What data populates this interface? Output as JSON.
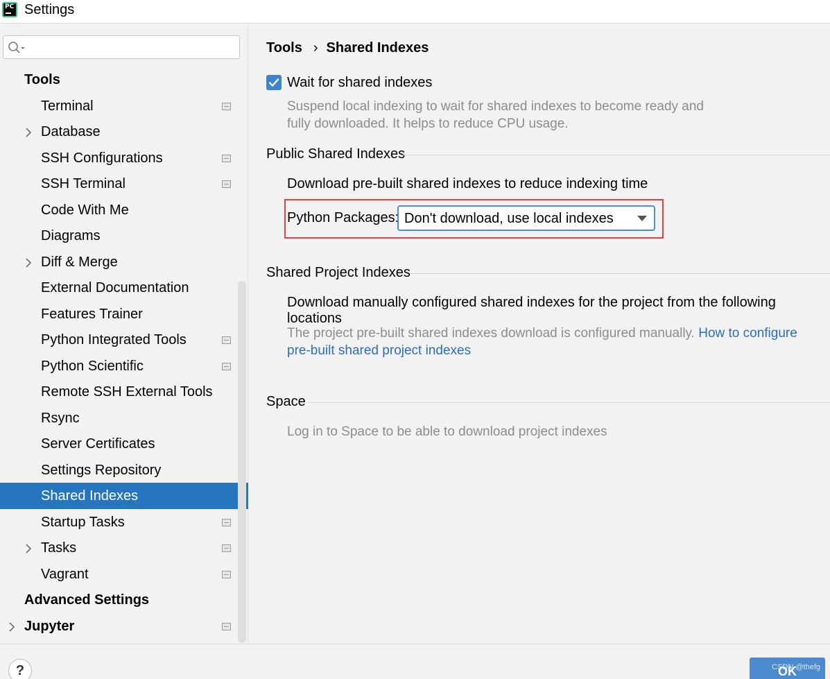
{
  "window": {
    "title": "Settings",
    "app_icon_text": "PC"
  },
  "search": {
    "placeholder": ""
  },
  "sidebar": {
    "items": [
      {
        "label": "Tools",
        "section": true
      },
      {
        "label": "Terminal",
        "project": true
      },
      {
        "label": "Database",
        "expandable": true
      },
      {
        "label": "SSH Configurations",
        "project": true
      },
      {
        "label": "SSH Terminal",
        "project": true
      },
      {
        "label": "Code With Me"
      },
      {
        "label": "Diagrams"
      },
      {
        "label": "Diff & Merge",
        "expandable": true
      },
      {
        "label": "External Documentation"
      },
      {
        "label": "Features Trainer"
      },
      {
        "label": "Python Integrated Tools",
        "project": true
      },
      {
        "label": "Python Scientific",
        "project": true
      },
      {
        "label": "Remote SSH External Tools"
      },
      {
        "label": "Rsync"
      },
      {
        "label": "Server Certificates"
      },
      {
        "label": "Settings Repository"
      },
      {
        "label": "Shared Indexes",
        "selected": true
      },
      {
        "label": "Startup Tasks",
        "project": true
      },
      {
        "label": "Tasks",
        "expandable": true,
        "project": true
      },
      {
        "label": "Vagrant",
        "project": true
      },
      {
        "label": "Advanced Settings",
        "section": true
      },
      {
        "label": "Jupyter",
        "section": true,
        "expandable": true,
        "project": true
      }
    ]
  },
  "breadcrumb": {
    "parent": "Tools",
    "separator": "›",
    "current": "Shared Indexes"
  },
  "wait_option": {
    "label": "Wait for shared indexes",
    "checked": true,
    "hint_line1": "Suspend local indexing to wait for shared indexes to become ready and",
    "hint_line2": "fully downloaded. It helps to reduce CPU usage."
  },
  "public_group": {
    "title": "Public Shared Indexes",
    "description": "Download pre-built shared indexes to reduce indexing time",
    "python_packages_label": "Python Packages:",
    "python_packages_value": "Don't download, use local indexes"
  },
  "project_group": {
    "title": "Shared Project Indexes",
    "description": "Download manually configured shared indexes for the project from the following locations",
    "hint": "The project pre-built shared indexes download is configured manually.",
    "link_part1": "How to configure",
    "link_part2": "pre-built shared project indexes"
  },
  "space_group": {
    "title": "Space",
    "hint": "Log in to Space to be able to download project indexes"
  },
  "footer": {
    "help_label": "?",
    "ok_label": "OK",
    "watermark": "CSDN @thefg"
  },
  "colors": {
    "selection": "#2675bf",
    "checkbox": "#4083c9",
    "link": "#2a6fb8",
    "highlight_border": "#e04040",
    "ok_button": "#4c8ad0"
  }
}
